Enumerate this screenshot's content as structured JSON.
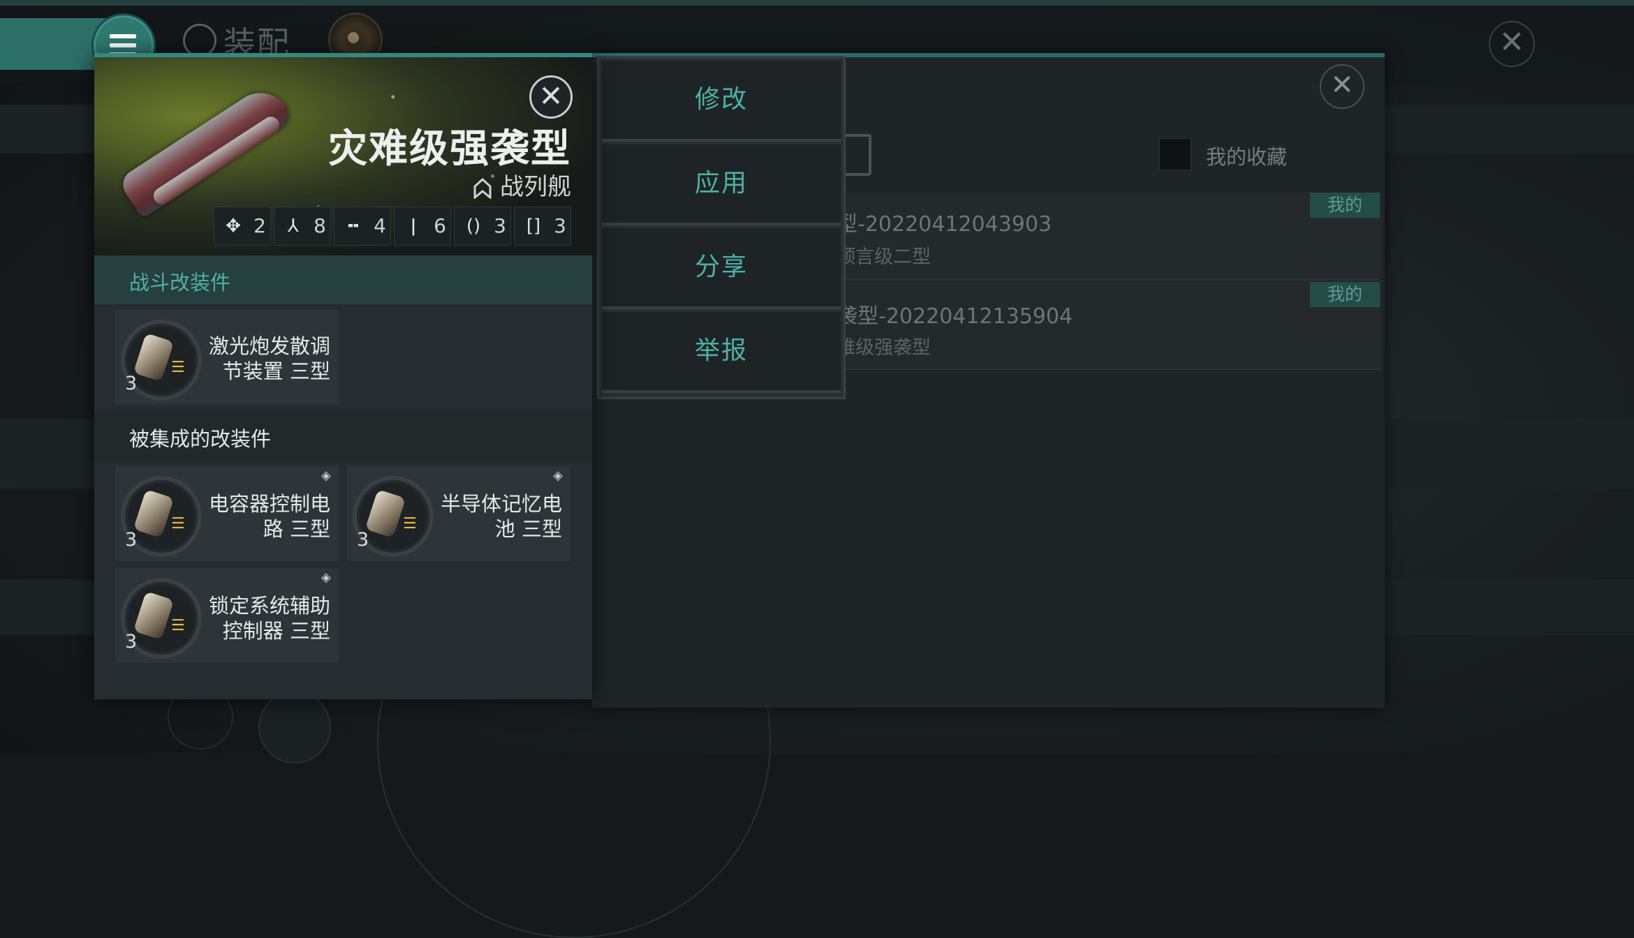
{
  "background": {
    "title": "装配",
    "rows": [
      {
        "title": "型-20220412043903",
        "subtitle": "预言级二型",
        "badge": "我的"
      },
      {
        "title": "袭型-20220412135904",
        "subtitle": "难级强袭型",
        "badge": "我的"
      }
    ],
    "favorites_label": "我的收藏"
  },
  "menu": {
    "items": [
      "修改",
      "应用",
      "分享",
      "举报"
    ]
  },
  "ship": {
    "name": "灾难级强袭型",
    "class": "战列舰",
    "stats": [
      {
        "icon": "drone-icon",
        "glyph": "✥",
        "value": "2"
      },
      {
        "icon": "fighter-icon",
        "glyph": "⅄",
        "value": "8"
      },
      {
        "icon": "low-slot-icon",
        "glyph": "╍",
        "value": "4"
      },
      {
        "icon": "mid-slot-icon",
        "glyph": "ǀ",
        "value": "6"
      },
      {
        "icon": "rig-icon",
        "glyph": "()",
        "value": "3"
      },
      {
        "icon": "subsystem-icon",
        "glyph": "[]",
        "value": "3"
      }
    ]
  },
  "combat_mods": {
    "header": "战斗改装件",
    "items": [
      {
        "name": "激光炮发散调节装置 三型",
        "level": "3",
        "grade": "☰"
      }
    ]
  },
  "integrated_mods": {
    "header": "被集成的改装件",
    "items": [
      {
        "name": "电容器控制电路 三型",
        "level": "3",
        "grade": "☰"
      },
      {
        "name": "半导体记忆电池 三型",
        "level": "3",
        "grade": "☰"
      },
      {
        "name": "锁定系统辅助控制器 三型",
        "level": "3",
        "grade": "☰"
      }
    ]
  },
  "colors": {
    "accent": "#2f8a80",
    "menu_text": "#4fb0a5",
    "grade": "#e8b64a"
  }
}
